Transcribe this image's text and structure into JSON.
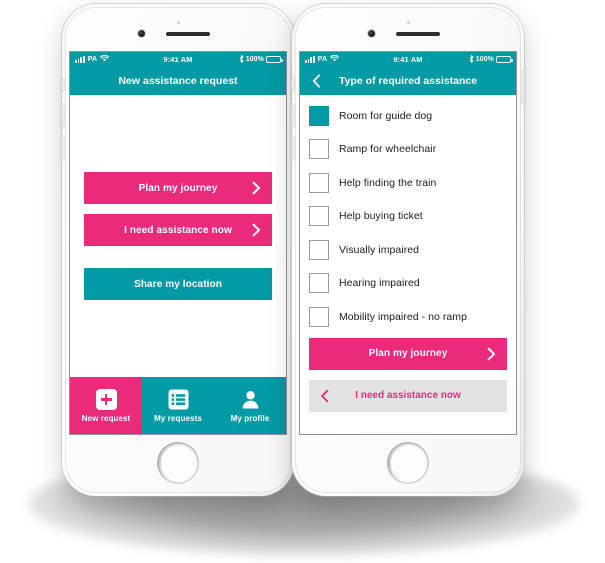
{
  "accent_colors": {
    "pink": "#ec2a7b",
    "teal": "#029aa5",
    "gray": "#e3e3e3",
    "text_dark": "#1d1d1d",
    "white": "#ffffff"
  },
  "status_bar": {
    "carrier": "PA",
    "wifi_icon": "wifi-icon",
    "signal_icon": "cellular-signal-icon",
    "time": "9:41 AM",
    "bluetooth_icon": "bluetooth-icon",
    "battery_percent": "100%",
    "battery_icon": "battery-full-icon"
  },
  "screen_left": {
    "header": {
      "title": "New assistance request"
    },
    "buttons": [
      {
        "label": "Plan my journey",
        "style": "pink",
        "chevron": "chevron-right-icon"
      },
      {
        "label": "I need assistance now",
        "style": "pink",
        "chevron": "chevron-right-icon"
      },
      {
        "label": "Share my location",
        "style": "teal",
        "chevron": ""
      }
    ],
    "tabs": [
      {
        "label": "New request",
        "icon": "plus-square-icon",
        "active": true
      },
      {
        "label": "My requests",
        "icon": "list-icon",
        "active": false
      },
      {
        "label": "My profile",
        "icon": "person-icon",
        "active": false
      }
    ]
  },
  "screen_right": {
    "header": {
      "back_icon": "chevron-left-icon",
      "title": "Type of required assistance"
    },
    "options": [
      {
        "label": "Room for guide dog",
        "checked": true
      },
      {
        "label": "Ramp for wheelchair",
        "checked": false
      },
      {
        "label": "Help finding the train",
        "checked": false
      },
      {
        "label": "Help buying ticket",
        "checked": false
      },
      {
        "label": "Visually impaired",
        "checked": false
      },
      {
        "label": "Hearing impaired",
        "checked": false
      },
      {
        "label": "Mobility impaired - no ramp",
        "checked": false
      }
    ],
    "primary_button": {
      "label": "Plan my journey",
      "chevron": "chevron-right-icon"
    },
    "secondary_button": {
      "label": "I need assistance now",
      "chevron": "chevron-left-icon"
    }
  }
}
